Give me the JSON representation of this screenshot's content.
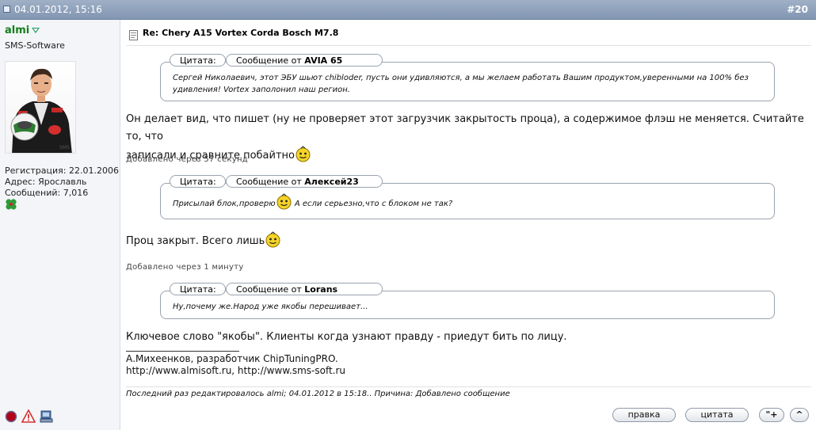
{
  "header": {
    "date": "04.01.2012, 15:16",
    "post_number": "#20"
  },
  "user": {
    "name": "almi",
    "title": "SMS-Software",
    "registered": "Регистрация: 22.01.2006",
    "location": "Адрес: Ярославль",
    "posts": "Сообщений: 7,016",
    "icons": [
      "status-online-icon",
      "report-warning-icon",
      "ip-computer-icon"
    ]
  },
  "post": {
    "title": "Re: Chery A15 Vortex Corda Bosch M7.8",
    "quotes": [
      {
        "label": "Цитата:",
        "from_prefix": "Сообщение от",
        "author": "AVIA 65",
        "lines": [
          "Сергей Николаевич, этот ЭБУ шьют chibloder, пусть они удивляются, а мы желаем работать Вашим продуктом,уверенными на 100% без",
          "удивления! Vortex заполонил наш регион."
        ]
      },
      {
        "label": "Цитата:",
        "from_prefix": "Сообщение от",
        "author": "Алексей23",
        "text_before": "Присылай блок,проверю",
        "text_after": " А если серьезно,что с блоком не так?"
      },
      {
        "label": "Цитата:",
        "from_prefix": "Сообщение от",
        "author": "Lorans",
        "text": "Ну,почему же.Народ уже якобы перешивает..."
      }
    ],
    "reply1_line1": "Он делает вид, что пишет (ну не проверяет этот загрузчик закрытость проца), а содержимое флэш не меняется. Считайте то, что",
    "reply1_line2": "записали и сравните побайтно",
    "added1": "Добавлено через 57 секунд",
    "reply2": "Проц закрыт. Всего лишь",
    "added2": "Добавлено через 1 минуту",
    "reply3": "Ключевое слово \"якобы\". Клиенты когда узнают правду - приедут бить по лицу.",
    "signature": {
      "line1": "А.Михеенков, разработчик ChipTuningPRO.",
      "line2": "http://www.almisoft.ru, http://www.sms-soft.ru"
    },
    "edited": "Последний раз редактировалось almi; 04.01.2012 в 15:18.. Причина: Добавлено сообщение"
  },
  "buttons": {
    "edit": "правка",
    "quote": "цитата",
    "multiquote": "\"+",
    "top": "^"
  },
  "colors": {
    "header": "#8ea1bc",
    "username": "#137d1b",
    "sidebar": "#f3f5f8"
  }
}
